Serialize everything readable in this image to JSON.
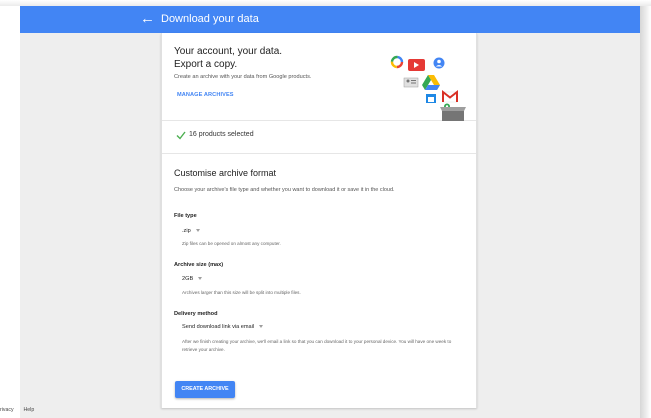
{
  "appbar": {
    "title": "Download your data",
    "back_icon": "arrow-back-icon"
  },
  "hero": {
    "title_line1": "Your account, your data.",
    "title_line2": "Export a copy.",
    "subtitle": "Create an archive with your data from Google products.",
    "manage_label": "MANAGE ARCHIVES",
    "icons": [
      "photos-icon",
      "youtube-icon",
      "contacts-icon",
      "drive-icon",
      "gmail-icon",
      "calendar-icon",
      "maps-icon",
      "box-icon"
    ]
  },
  "selection": {
    "text": "16 products selected",
    "check_icon": "check-icon",
    "check_color": "#4caf50"
  },
  "format": {
    "title": "Customise archive format",
    "subtitle": "Choose your archive's file type and whether you want to download it or save it in the cloud.",
    "file_type": {
      "label": "File type",
      "value": ".zip",
      "help": "Zip files can be opened on almost any computer."
    },
    "archive_size": {
      "label": "Archive size (max)",
      "value": "2GB",
      "help": "Archives larger than this size will be split into multiple files."
    },
    "delivery": {
      "label": "Delivery method",
      "value": "Send download link via email",
      "help": "After we finish creating your archive, we'll email a link so that you can download it to your personal device. You will have one week to retrieve your archive."
    }
  },
  "create_label": "CREATE ARCHIVE",
  "footer": {
    "privacy": "rivacy",
    "help": "Help"
  },
  "colors": {
    "accent": "#4285f4",
    "background": "#eeeeee"
  }
}
